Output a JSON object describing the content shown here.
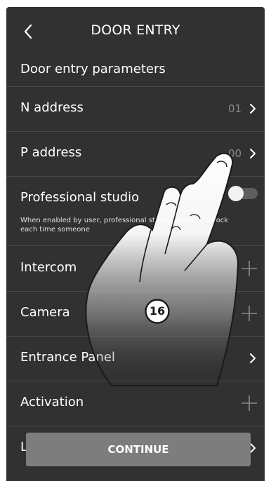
{
  "header": {
    "title": "DOOR ENTRY"
  },
  "section": {
    "title": "Door entry parameters"
  },
  "rows": {
    "n_address": {
      "label": "N address",
      "value": "01"
    },
    "p_address": {
      "label": "P address",
      "value": "00"
    },
    "professional_studio": {
      "label": "Professional studio",
      "enabled": false
    },
    "intercom": {
      "label": "Intercom"
    },
    "camera": {
      "label": "Camera"
    },
    "entrance_panel": {
      "label": "Entrance Panel"
    },
    "activation": {
      "label": "Activation"
    },
    "partial_last": {
      "label": "L"
    }
  },
  "note": "When enabled by user, professional studio opens door lock each time someone",
  "callout": {
    "number": "16"
  },
  "footer": {
    "continue_label": "CONTINUE"
  },
  "colors": {
    "background": "#313131",
    "button": "#7d7d7d",
    "separator": "#4a4a4a",
    "muted_text": "#8a8a8a"
  },
  "icons": {
    "back": "chevron-left-icon",
    "next": "chevron-right-icon",
    "add": "plus-icon"
  }
}
